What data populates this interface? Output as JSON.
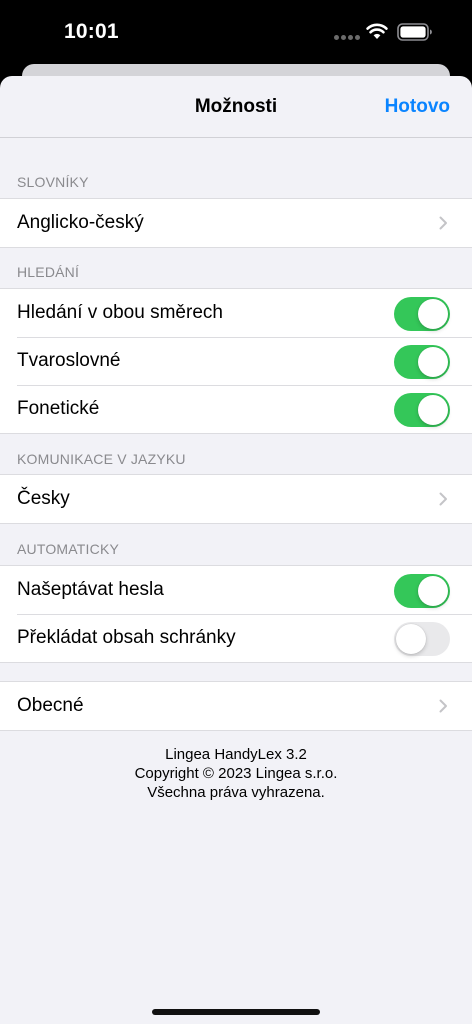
{
  "status_bar": {
    "time": "10:01"
  },
  "navbar": {
    "title": "Možnosti",
    "done_label": "Hotovo",
    "accent_color": "#0a84ff"
  },
  "sections": {
    "dictionaries": {
      "header": "SLOVNÍKY",
      "items": [
        {
          "label": "Anglicko-český",
          "type": "disclosure"
        }
      ]
    },
    "search": {
      "header": "HLEDÁNÍ",
      "items": [
        {
          "label": "Hledání v obou směrech",
          "type": "toggle",
          "on": true
        },
        {
          "label": "Tvaroslovné",
          "type": "toggle",
          "on": true
        },
        {
          "label": "Fonetické",
          "type": "toggle",
          "on": true
        }
      ]
    },
    "language": {
      "header": "KOMUNIKACE V JAZYKU",
      "items": [
        {
          "label": "Česky",
          "type": "disclosure"
        }
      ]
    },
    "automatic": {
      "header": "AUTOMATICKY",
      "items": [
        {
          "label": "Našeptávat hesla",
          "type": "toggle",
          "on": true
        },
        {
          "label": "Překládat obsah schránky",
          "type": "toggle",
          "on": false
        }
      ]
    },
    "general": {
      "items": [
        {
          "label": "Obecné",
          "type": "disclosure"
        }
      ]
    }
  },
  "footer": {
    "line1": "Lingea HandyLex 3.2",
    "line2": "Copyright © 2023 Lingea s.r.o.",
    "line3": "Všechna práva vyhrazena."
  },
  "colors": {
    "toggle_on": "#34c759",
    "toggle_off": "#e9e9eb",
    "background": "#f2f2f7"
  },
  "icons": {
    "disclosure": "chevron-right-icon",
    "wifi": "wifi-icon",
    "battery": "battery-icon"
  }
}
